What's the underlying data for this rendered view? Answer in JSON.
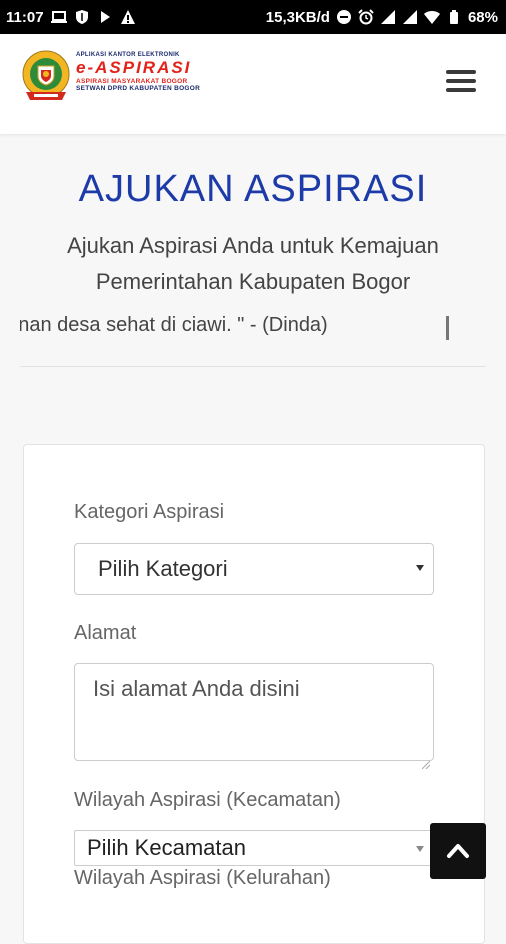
{
  "status_bar": {
    "time": "11:07",
    "speed": "15,3KB/d",
    "battery": "68%",
    "icons_left": [
      "laptop-icon",
      "shield-icon",
      "play-icon",
      "warning-icon"
    ],
    "icons_right": [
      "dnd-icon",
      "alarm-icon",
      "signal-icon",
      "signal-icon",
      "wifi-icon",
      "battery-icon"
    ]
  },
  "header": {
    "logo": {
      "top_line": "APLIKASI KANTOR ELEKTRONIK",
      "brand": "e-ASPIRASI",
      "sub_line_1": "ASPIRASI MASYARAKAT BOGOR",
      "sub_line_2": "SETWAN DPRD KABUPATEN BOGOR"
    },
    "menu_icon": "hamburger-menu-icon"
  },
  "main": {
    "title": "AJUKAN ASPIRASI",
    "subtitle": "Ajukan Aspirasi Anda untuk Kemajuan Pemerintahan Kabupaten Bogor",
    "ticker_text": "ayanan desa sehat di ciawi. \" - (Dinda)"
  },
  "form": {
    "kategori": {
      "label": "Kategori Aspirasi",
      "selected": "Pilih Kategori"
    },
    "alamat": {
      "label": "Alamat",
      "placeholder": "Isi alamat Anda disini"
    },
    "wilayah": {
      "label": "Wilayah Aspirasi (Kecamatan)",
      "selected": "Pilih Kecamatan"
    },
    "next_label_partial": "Wilayah Aspirasi (Kelurahan)"
  },
  "colors": {
    "title_blue": "#1d3ba8",
    "brand_red": "#e2231a",
    "back_to_top_bg": "#111111"
  }
}
